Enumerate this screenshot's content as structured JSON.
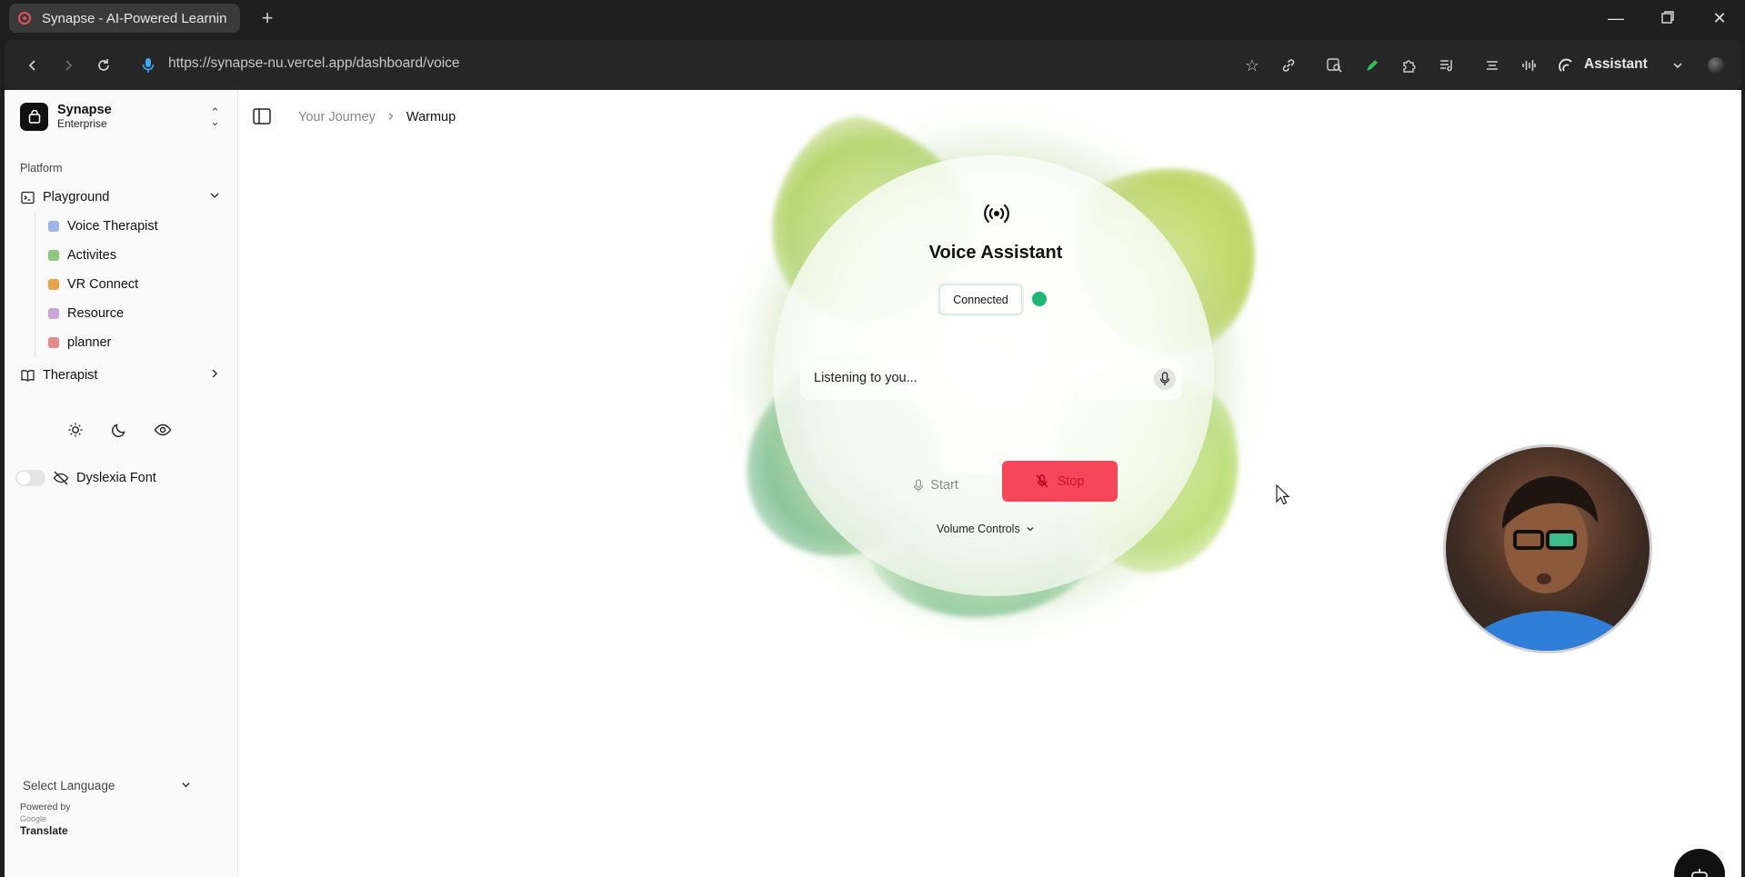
{
  "browser": {
    "tab_title": "Synapse - AI-Powered Learnin",
    "url": "https://synapse-nu.vercel.app/dashboard/voice",
    "assistant_label": "Assistant"
  },
  "sidebar": {
    "brand_name": "Synapse",
    "brand_plan": "Enterprise",
    "group_label": "Platform",
    "playground": {
      "label": "Playground",
      "items": [
        {
          "label": "Voice Therapist",
          "icon": "speaker-emoji",
          "color": "#9fb6e8"
        },
        {
          "label": "Activites",
          "icon": "puzzle-emoji",
          "color": "#8cc87a"
        },
        {
          "label": "VR Connect",
          "icon": "person-emoji",
          "color": "#e8a24a"
        },
        {
          "label": "Resource",
          "icon": "book-emoji",
          "color": "#c9a6d8"
        },
        {
          "label": "planner",
          "icon": "notebook-emoji",
          "color": "#e38a8a"
        }
      ]
    },
    "therapist_label": "Therapist",
    "dyslexia_label": "Dyslexia Font",
    "language_label": "Select Language",
    "powered_by": "Powered by",
    "google": "Google",
    "translate": "Translate"
  },
  "breadcrumb": {
    "parent": "Your Journey",
    "current": "Warmup"
  },
  "voice": {
    "title": "Voice Assistant",
    "status": "Connected",
    "status_color": "#19b874",
    "listening_text": "Listening to you...",
    "start_label": "Start",
    "stop_label": "Stop",
    "stop_color": "#f5465a",
    "volume_label": "Volume Controls"
  }
}
